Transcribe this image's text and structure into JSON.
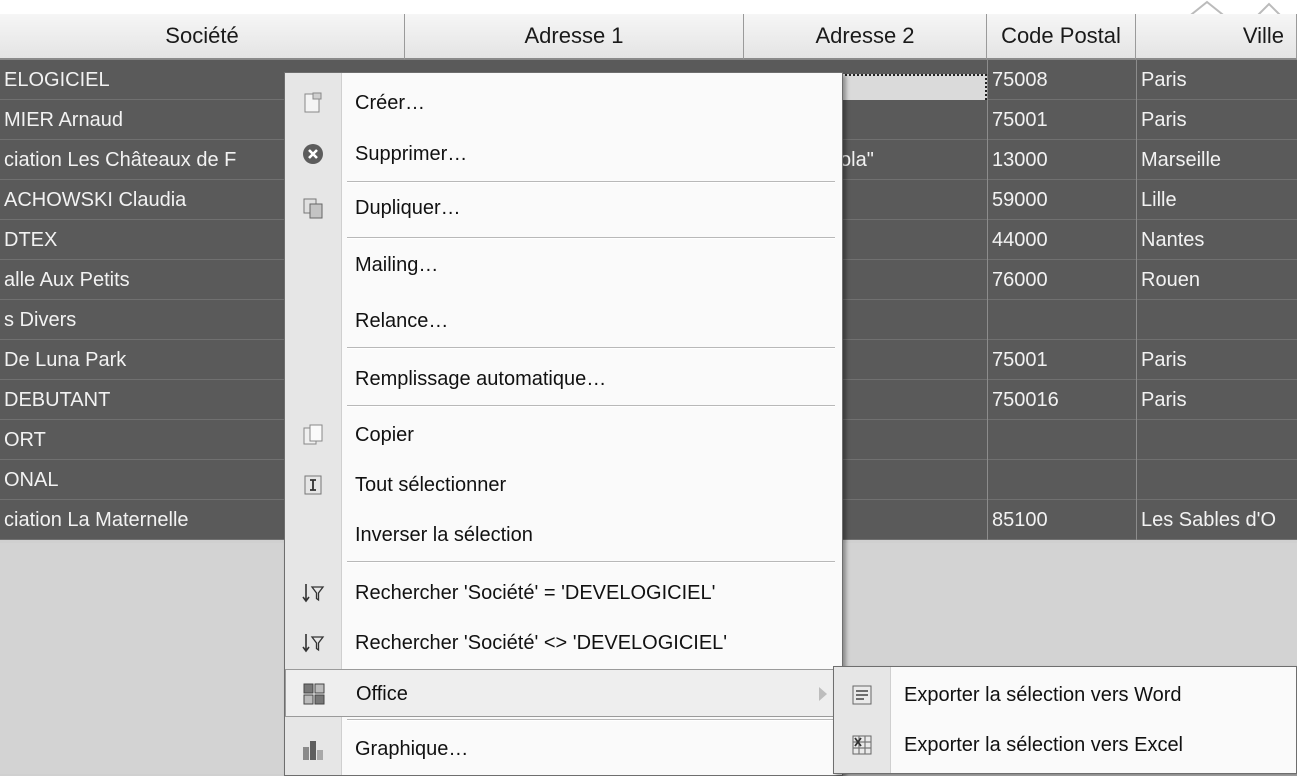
{
  "grid": {
    "columns": [
      {
        "label": "Société"
      },
      {
        "label": "Adresse 1"
      },
      {
        "label": "Adresse 2"
      },
      {
        "label": "Code Postal"
      },
      {
        "label": "Ville"
      }
    ],
    "rows": [
      {
        "societe": "ELOGICIEL",
        "adresse2": "",
        "code_postal": "75008",
        "ville": "Paris"
      },
      {
        "societe": "MIER Arnaud",
        "adresse2": "",
        "code_postal": "75001",
        "ville": "Paris"
      },
      {
        "societe": "ciation Les Châteaux de F",
        "adresse2": "ola\"",
        "code_postal": "13000",
        "ville": "Marseille"
      },
      {
        "societe": "ACHOWSKI Claudia",
        "adresse2": "",
        "code_postal": "59000",
        "ville": "Lille"
      },
      {
        "societe": "DTEX",
        "adresse2": "",
        "code_postal": "44000",
        "ville": "Nantes"
      },
      {
        "societe": "alle Aux Petits",
        "adresse2": "",
        "code_postal": "76000",
        "ville": "Rouen"
      },
      {
        "societe": "s Divers",
        "adresse2": "",
        "code_postal": "",
        "ville": ""
      },
      {
        "societe": "De Luna Park",
        "adresse2": "",
        "code_postal": "75001",
        "ville": "Paris"
      },
      {
        "societe": "DEBUTANT",
        "adresse2": "",
        "code_postal": "750016",
        "ville": "Paris"
      },
      {
        "societe": "ORT",
        "adresse2": "",
        "code_postal": "",
        "ville": ""
      },
      {
        "societe": "ONAL",
        "adresse2": "",
        "code_postal": "",
        "ville": ""
      },
      {
        "societe": "ciation La Maternelle",
        "adresse2": "",
        "code_postal": "85100",
        "ville": "Les Sables d'O"
      }
    ]
  },
  "context_menu": {
    "items": [
      {
        "label": "Créer…",
        "icon": "create-icon"
      },
      {
        "label": "Supprimer…",
        "icon": "delete-icon"
      },
      {
        "label": "Dupliquer…",
        "icon": "duplicate-icon"
      },
      {
        "label": "Mailing…"
      },
      {
        "label": "Relance…"
      },
      {
        "label": "Remplissage automatique…"
      },
      {
        "label": "Copier",
        "icon": "copy-icon"
      },
      {
        "label": "Tout sélectionner",
        "icon": "select-all-icon"
      },
      {
        "label": "Inverser la sélection"
      },
      {
        "label": "Rechercher 'Société' = 'DEVELOGICIEL'",
        "icon": "filter-icon"
      },
      {
        "label": "Rechercher 'Société' <> 'DEVELOGICIEL'",
        "icon": "filter-icon"
      },
      {
        "label": "Office",
        "icon": "office-icon",
        "has_submenu": true,
        "highlighted": true
      },
      {
        "label": "Graphique…",
        "icon": "chart-icon"
      }
    ]
  },
  "submenu": {
    "items": [
      {
        "label": "Exporter la sélection vers Word",
        "icon": "word-icon"
      },
      {
        "label": "Exporter la sélection vers Excel",
        "icon": "excel-icon"
      }
    ]
  },
  "colors": {
    "row_bg": "#5a5a5a",
    "menu_bg": "#fafafa",
    "gutter_bg": "#e6e6e6"
  }
}
